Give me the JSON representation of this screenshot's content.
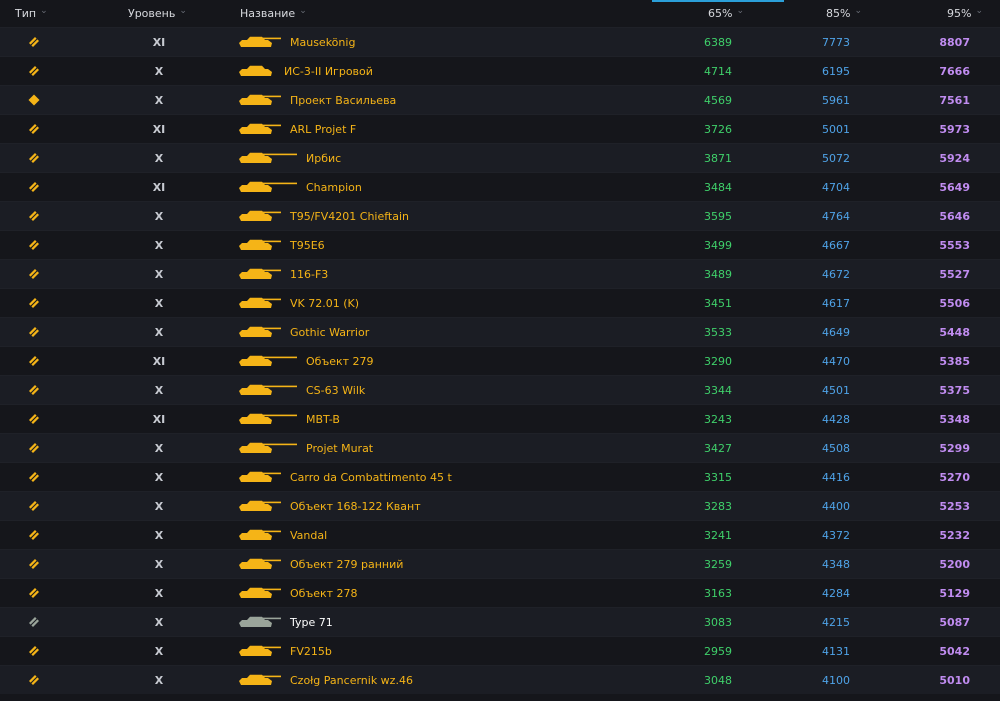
{
  "header": {
    "type": "Тип",
    "tier": "Уровень",
    "name": "Название",
    "p65": "65%",
    "p85": "85%",
    "p95": "95%"
  },
  "colors": {
    "premium": "#f5b417",
    "standard": "#9aa49a",
    "p65": "#3fd06a",
    "p85": "#4fa3e8",
    "p95": "#c08cf0"
  },
  "rows": [
    {
      "type": "chevron-icon",
      "tier": "XI",
      "name": "Mausekönig",
      "p65": "6389",
      "p85": "7773",
      "p95": "8807",
      "premium": true,
      "gun": "short"
    },
    {
      "type": "chevron-icon",
      "tier": "X",
      "name": "ИС-3-II Игровой",
      "p65": "4714",
      "p85": "6195",
      "p95": "7666",
      "premium": true,
      "gun": "none"
    },
    {
      "type": "diamond-icon",
      "tier": "X",
      "name": "Проект Васильева",
      "p65": "4569",
      "p85": "5961",
      "p95": "7561",
      "premium": true,
      "gun": "short"
    },
    {
      "type": "chevron-icon",
      "tier": "XI",
      "name": "ARL Projet F",
      "p65": "3726",
      "p85": "5001",
      "p95": "5973",
      "premium": true,
      "gun": "short"
    },
    {
      "type": "chevron-icon",
      "tier": "X",
      "name": "Ирбис",
      "p65": "3871",
      "p85": "5072",
      "p95": "5924",
      "premium": true,
      "gun": "long"
    },
    {
      "type": "chevron-icon",
      "tier": "XI",
      "name": "Champion",
      "p65": "3484",
      "p85": "4704",
      "p95": "5649",
      "premium": true,
      "gun": "long"
    },
    {
      "type": "chevron-icon",
      "tier": "X",
      "name": "T95/FV4201 Chieftain",
      "p65": "3595",
      "p85": "4764",
      "p95": "5646",
      "premium": true,
      "gun": "short"
    },
    {
      "type": "chevron-icon",
      "tier": "X",
      "name": "T95E6",
      "p65": "3499",
      "p85": "4667",
      "p95": "5553",
      "premium": true,
      "gun": "short"
    },
    {
      "type": "chevron-icon",
      "tier": "X",
      "name": "116-F3",
      "p65": "3489",
      "p85": "4672",
      "p95": "5527",
      "premium": true,
      "gun": "short"
    },
    {
      "type": "chevron-icon",
      "tier": "X",
      "name": "VK 72.01 (K)",
      "p65": "3451",
      "p85": "4617",
      "p95": "5506",
      "premium": true,
      "gun": "short"
    },
    {
      "type": "chevron-icon",
      "tier": "X",
      "name": "Gothic Warrior",
      "p65": "3533",
      "p85": "4649",
      "p95": "5448",
      "premium": true,
      "gun": "short"
    },
    {
      "type": "chevron-icon",
      "tier": "XI",
      "name": "Объект 279",
      "p65": "3290",
      "p85": "4470",
      "p95": "5385",
      "premium": true,
      "gun": "long"
    },
    {
      "type": "chevron-icon",
      "tier": "X",
      "name": "CS-63 Wilk",
      "p65": "3344",
      "p85": "4501",
      "p95": "5375",
      "premium": true,
      "gun": "long"
    },
    {
      "type": "chevron-icon",
      "tier": "XI",
      "name": "MBT-B",
      "p65": "3243",
      "p85": "4428",
      "p95": "5348",
      "premium": true,
      "gun": "long"
    },
    {
      "type": "chevron-icon",
      "tier": "X",
      "name": "Projet Murat",
      "p65": "3427",
      "p85": "4508",
      "p95": "5299",
      "premium": true,
      "gun": "long"
    },
    {
      "type": "chevron-icon",
      "tier": "X",
      "name": "Carro da Combattimento 45 t",
      "p65": "3315",
      "p85": "4416",
      "p95": "5270",
      "premium": true,
      "gun": "short"
    },
    {
      "type": "chevron-icon",
      "tier": "X",
      "name": "Объект 168-122 Квант",
      "p65": "3283",
      "p85": "4400",
      "p95": "5253",
      "premium": true,
      "gun": "short"
    },
    {
      "type": "chevron-icon",
      "tier": "X",
      "name": "Vandal",
      "p65": "3241",
      "p85": "4372",
      "p95": "5232",
      "premium": true,
      "gun": "short"
    },
    {
      "type": "chevron-icon",
      "tier": "X",
      "name": "Объект 279 ранний",
      "p65": "3259",
      "p85": "4348",
      "p95": "5200",
      "premium": true,
      "gun": "short"
    },
    {
      "type": "chevron-icon",
      "tier": "X",
      "name": "Объект 278",
      "p65": "3163",
      "p85": "4284",
      "p95": "5129",
      "premium": true,
      "gun": "short"
    },
    {
      "type": "chevron-icon",
      "tier": "X",
      "name": "Type 71",
      "p65": "3083",
      "p85": "4215",
      "p95": "5087",
      "premium": false,
      "gun": "short"
    },
    {
      "type": "chevron-icon",
      "tier": "X",
      "name": "FV215b",
      "p65": "2959",
      "p85": "4131",
      "p95": "5042",
      "premium": true,
      "gun": "short"
    },
    {
      "type": "chevron-icon",
      "tier": "X",
      "name": "Czołg Pancernik wz.46",
      "p65": "3048",
      "p85": "4100",
      "p95": "5010",
      "premium": true,
      "gun": "short"
    }
  ]
}
